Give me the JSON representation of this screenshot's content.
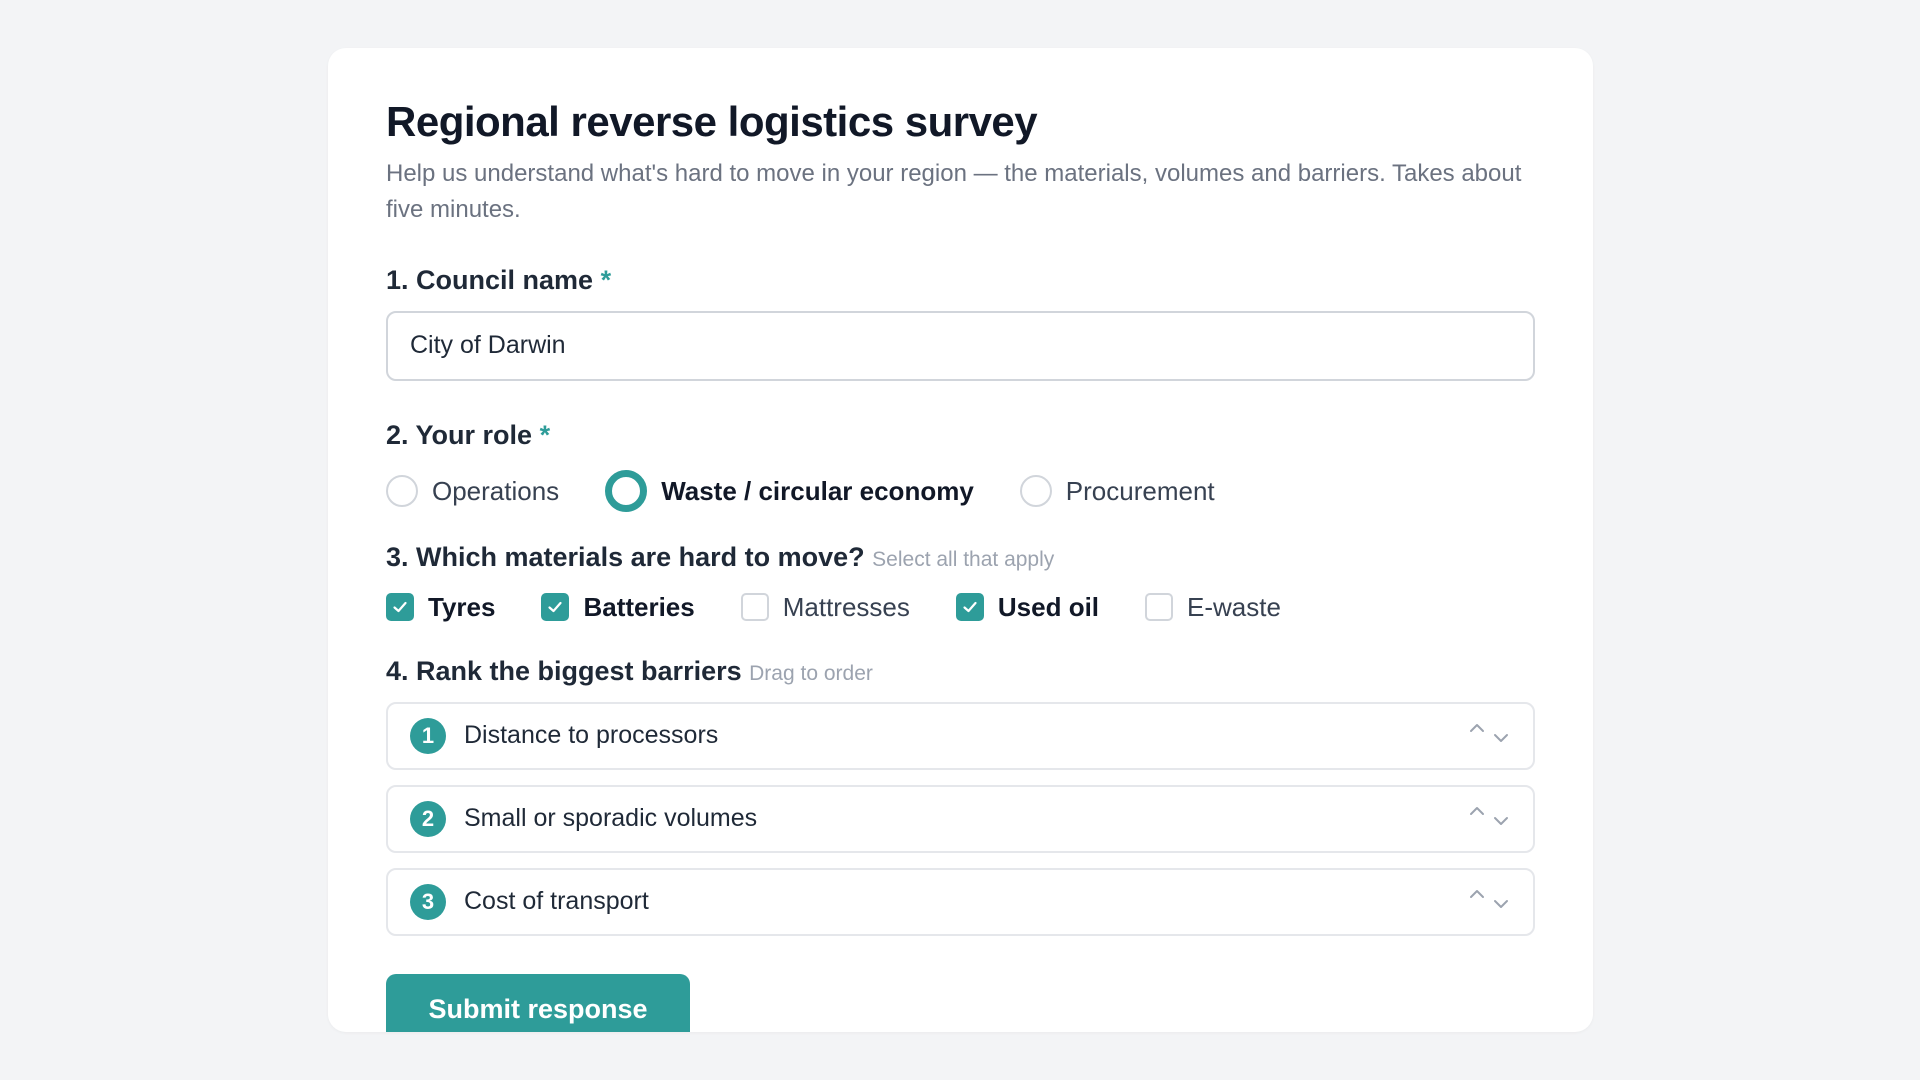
{
  "survey": {
    "title": "Regional reverse logistics survey",
    "subtitle": "Help us understand what's hard to move in your region — the materials, volumes and barriers. Takes about five minutes."
  },
  "q1": {
    "label": "1. Council name",
    "required_mark": "*",
    "value": "City of Darwin"
  },
  "q2": {
    "label": "2. Your role",
    "required_mark": "*",
    "options": [
      {
        "label": "Operations",
        "selected": false
      },
      {
        "label": "Waste / circular economy",
        "selected": true
      },
      {
        "label": "Procurement",
        "selected": false
      }
    ]
  },
  "q3": {
    "label": "3. Which materials are hard to move?",
    "hint": "Select all that apply",
    "options": [
      {
        "label": "Tyres",
        "checked": true
      },
      {
        "label": "Batteries",
        "checked": true
      },
      {
        "label": "Mattresses",
        "checked": false
      },
      {
        "label": "Used oil",
        "checked": true
      },
      {
        "label": "E-waste",
        "checked": false
      }
    ]
  },
  "q4": {
    "label": "4. Rank the biggest barriers",
    "hint": "Drag to order",
    "items": [
      {
        "rank": "1",
        "label": "Distance to processors"
      },
      {
        "rank": "2",
        "label": "Small or sporadic volumes"
      },
      {
        "rank": "3",
        "label": "Cost of transport"
      }
    ]
  },
  "submit_label": "Submit response",
  "colors": {
    "accent": "#2e9c99",
    "background": "#f3f4f6",
    "card": "#ffffff"
  }
}
